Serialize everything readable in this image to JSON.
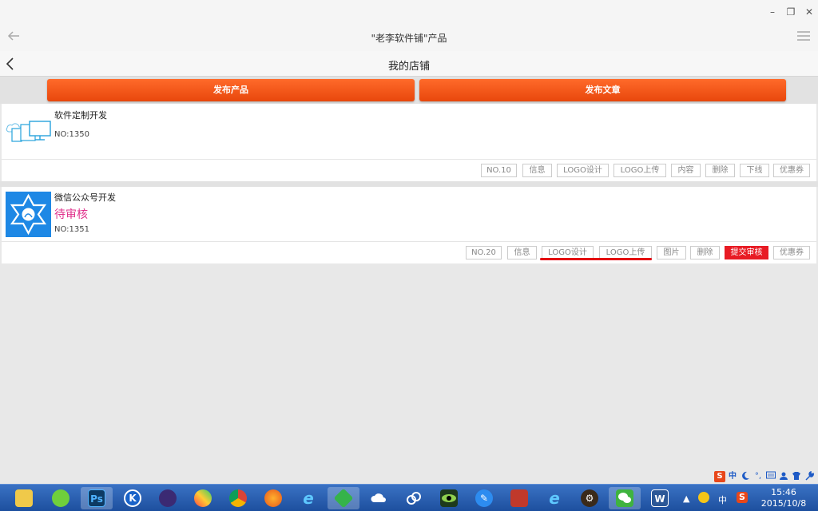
{
  "window": {
    "minimize": "–",
    "maximize": "❐",
    "close": "✕"
  },
  "app_bar": {
    "title": "\"老李软件铺\"产品"
  },
  "page_header": {
    "title": "我的店铺"
  },
  "actions": {
    "publish_product": "发布产品",
    "publish_article": "发布文章"
  },
  "products": [
    {
      "name": "软件定制开发",
      "status": "",
      "no": "NO:1350",
      "buttons": [
        "NO.10",
        "信息",
        "LOGO设计",
        "LOGO上传",
        "内容",
        "删除",
        "下线",
        "优惠券"
      ]
    },
    {
      "name": "微信公众号开发",
      "status": "待审核",
      "no": "NO:1351",
      "buttons": [
        "NO.20",
        "信息",
        "LOGO设计",
        "LOGO上传",
        "图片",
        "删除",
        "提交审核",
        "优惠券"
      ],
      "highlight_button": "提交审核"
    }
  ],
  "colors": {
    "accent": "#e8470c",
    "status_pending": "#e0308c",
    "submit": "#e81b24",
    "annotation": "#e30011"
  },
  "tray": {
    "ime": "中",
    "ime2": "中"
  },
  "taskbar": {
    "apps": [
      "file-explorer",
      "app-green",
      "photoshop",
      "k-app",
      "eclipse",
      "app-colorful",
      "chrome",
      "firefox",
      "ie",
      "app-green-diamond",
      "cloud-app",
      "baidu-cloud",
      "eye-app",
      "pen-app",
      "gift-app",
      "ie-2",
      "gear-app",
      "wechat",
      "word"
    ],
    "ps_label": "Ps",
    "k_label": "K",
    "word_label": "W"
  },
  "clock": {
    "time": "15:46",
    "date": "2015/10/8"
  }
}
